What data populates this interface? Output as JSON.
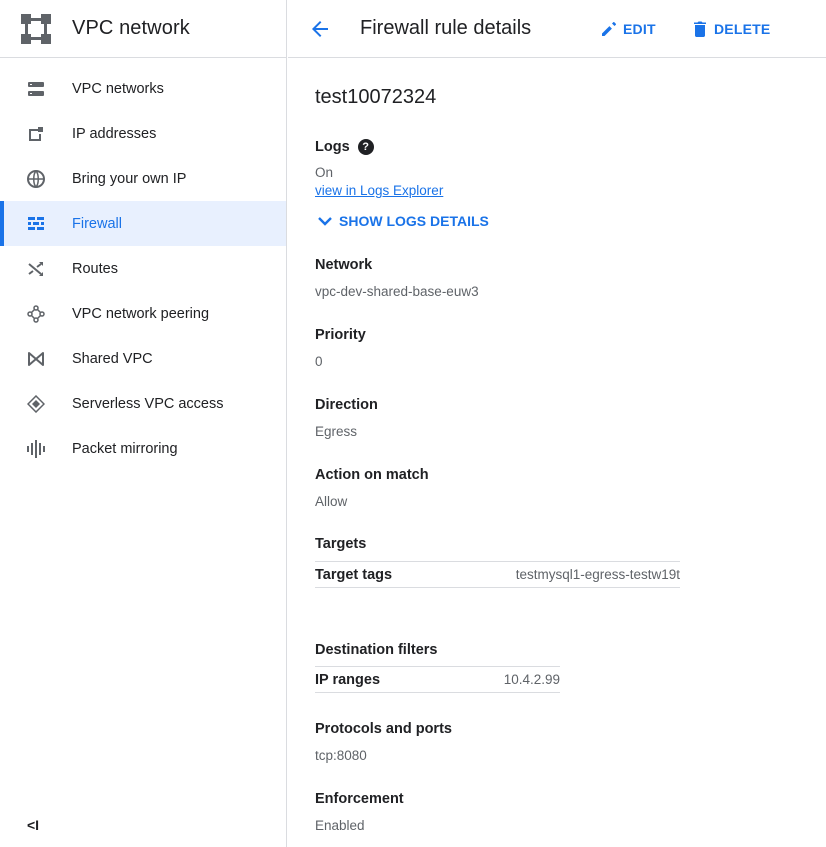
{
  "sidebar": {
    "title": "VPC network",
    "items": [
      {
        "label": "VPC networks",
        "icon": "vpc-networks-icon"
      },
      {
        "label": "IP addresses",
        "icon": "ip-addresses-icon"
      },
      {
        "label": "Bring your own IP",
        "icon": "globe-icon"
      },
      {
        "label": "Firewall",
        "icon": "firewall-icon",
        "active": true
      },
      {
        "label": "Routes",
        "icon": "routes-icon"
      },
      {
        "label": "VPC network peering",
        "icon": "peering-icon"
      },
      {
        "label": "Shared VPC",
        "icon": "shared-vpc-icon"
      },
      {
        "label": "Serverless VPC access",
        "icon": "serverless-icon"
      },
      {
        "label": "Packet mirroring",
        "icon": "packet-mirroring-icon"
      }
    ],
    "collapse_label": "<I"
  },
  "header": {
    "title": "Firewall rule details",
    "edit_label": "EDIT",
    "delete_label": "DELETE"
  },
  "rule": {
    "name": "test10072324",
    "logs": {
      "label": "Logs",
      "help": "?",
      "value": "On",
      "link": "view in Logs Explorer",
      "show_details": "SHOW LOGS DETAILS"
    },
    "network": {
      "label": "Network",
      "value": "vpc-dev-shared-base-euw3"
    },
    "priority": {
      "label": "Priority",
      "value": "0"
    },
    "direction": {
      "label": "Direction",
      "value": "Egress"
    },
    "action": {
      "label": "Action on match",
      "value": "Allow"
    },
    "targets": {
      "label": "Targets",
      "key": "Target tags",
      "value": "testmysql1-egress-testw19t"
    },
    "destination": {
      "label": "Destination filters",
      "key": "IP ranges",
      "value": "10.4.2.99"
    },
    "protocols": {
      "label": "Protocols and ports",
      "value": "tcp:8080"
    },
    "enforcement": {
      "label": "Enforcement",
      "value": "Enabled"
    }
  },
  "colors": {
    "accent": "#1a73e8",
    "active_bg": "#e8f0fe",
    "icon": "#5f6368"
  }
}
